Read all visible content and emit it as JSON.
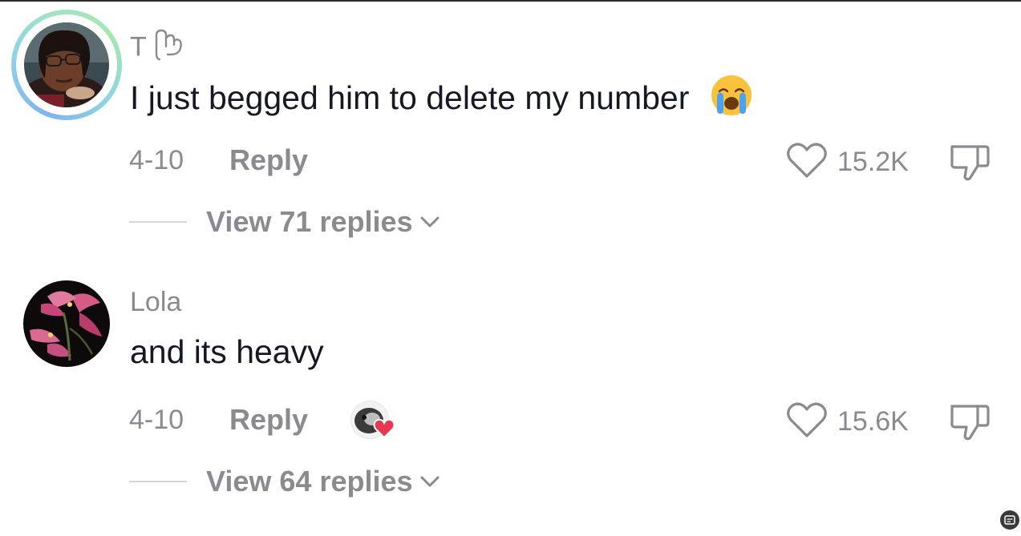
{
  "comments": [
    {
      "username": "T",
      "text": "I just begged him to delete my number",
      "date": "4-10",
      "reply_label": "Reply",
      "likes": "15.2K",
      "view_replies": "View 71 replies",
      "avatar_icon": "avatar-photo",
      "has_story_ring": true
    },
    {
      "username": "Lola",
      "text": "and its heavy",
      "date": "4-10",
      "reply_label": "Reply",
      "likes": "15.6K",
      "view_replies": "View 64 replies",
      "avatar_icon": "avatar-flower-photo",
      "creator_liked": true
    }
  ],
  "emoji": "😭",
  "colors": {
    "text_primary": "#161823",
    "text_secondary": "#8a8b91",
    "divider": "#d6d7da",
    "heart_red": "#e8384f",
    "ring_start": "#7fb3f0",
    "ring_end": "#a8e6b0"
  }
}
